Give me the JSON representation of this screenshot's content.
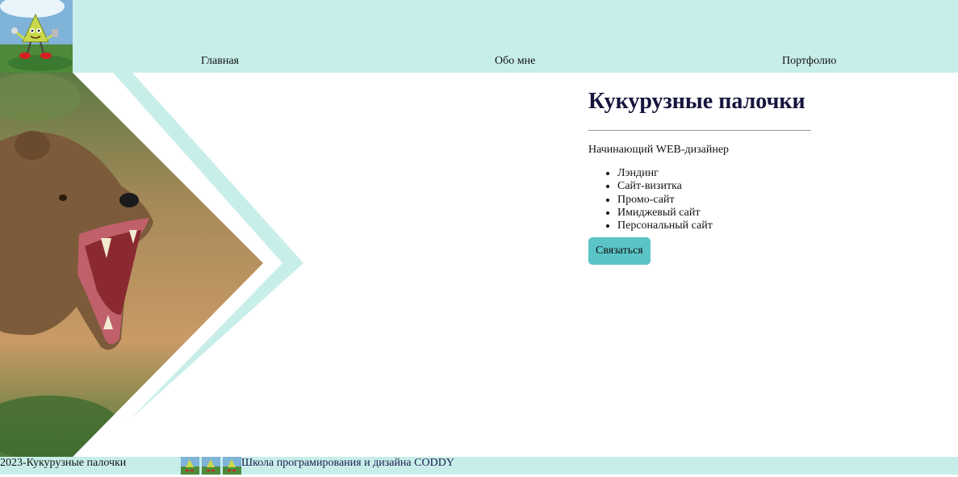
{
  "nav": {
    "items": [
      {
        "label": "Главная"
      },
      {
        "label": "Обо мне"
      },
      {
        "label": "Портфолио"
      }
    ]
  },
  "hero": {
    "image": "roaring-bear-photo",
    "accent_color": "#c8eeea"
  },
  "content": {
    "title": "Кукурузные палочки",
    "subtitle": "Начинающий WEB-дизайнер",
    "services": [
      "Лэндинг",
      "Сайт-визитка",
      "Промо-сайт",
      "Имиджевый сайт",
      "Персональный сайт"
    ],
    "contact_button": "Связаться"
  },
  "footer": {
    "copyright": "2023-Кукурузные палочки",
    "school": "Школа програмирования и дизайна CODDY"
  },
  "colors": {
    "header_bg": "#c8eeea",
    "button_bg": "#5bc4c6",
    "title_color": "#14143c"
  }
}
